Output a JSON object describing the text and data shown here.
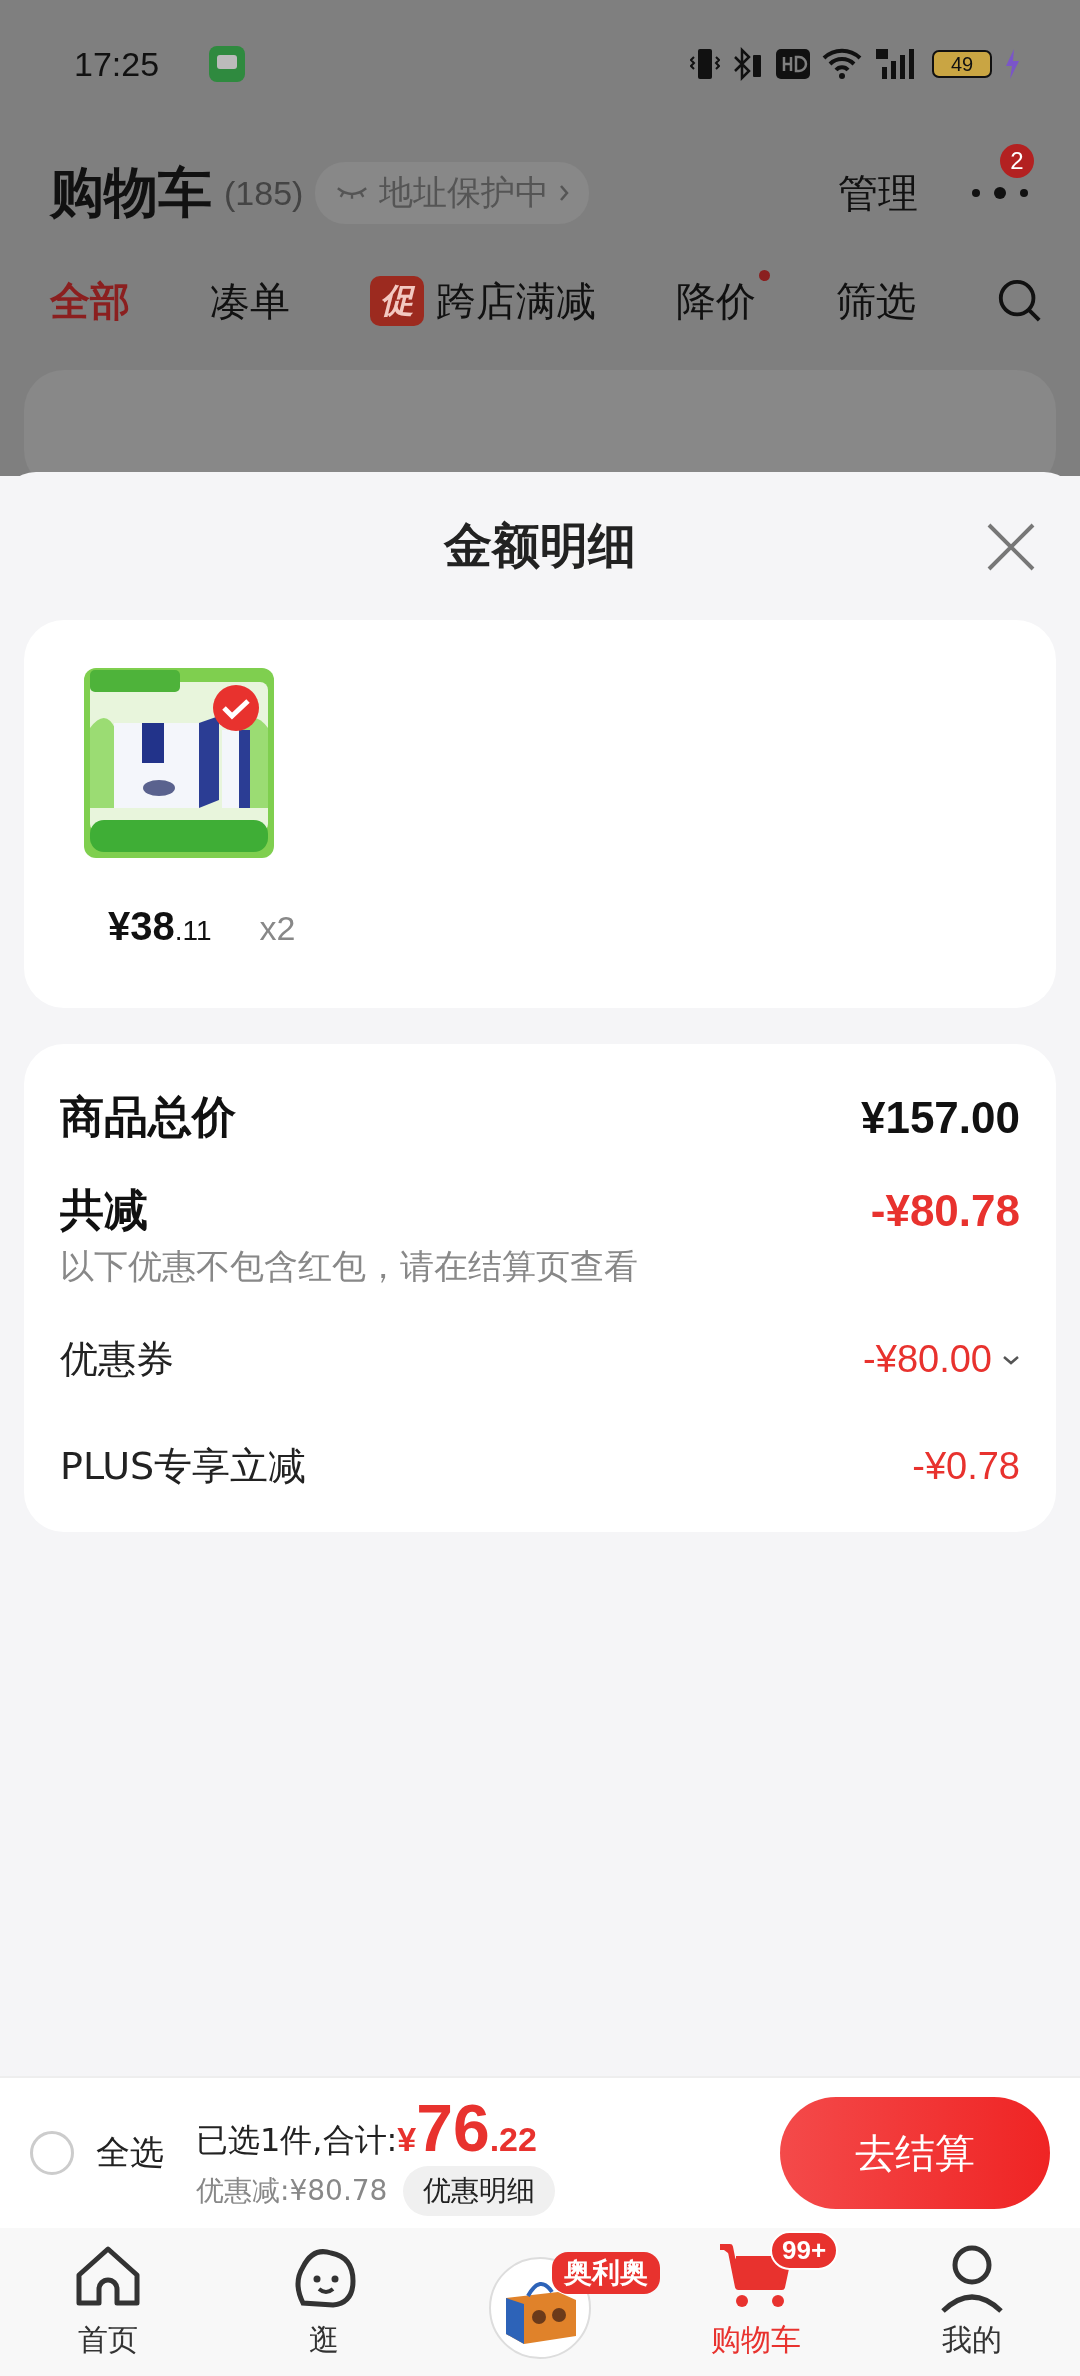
{
  "status_bar": {
    "time": "17:25",
    "battery": "49"
  },
  "header": {
    "title": "购物车",
    "count": "(185)",
    "address_chip": "地址保护中",
    "manage": "管理",
    "more_badge": "2"
  },
  "tabs": [
    {
      "label": "全部",
      "selected": true,
      "dot": false
    },
    {
      "label": "凑单",
      "selected": false,
      "dot": false
    },
    {
      "label": "跨店满减",
      "selected": false,
      "dot": false,
      "tag": "促"
    },
    {
      "label": "降价",
      "selected": false,
      "dot": true
    },
    {
      "label": "筛选",
      "selected": false,
      "dot": false
    }
  ],
  "sheet": {
    "title": "金额明细",
    "product": {
      "kind": "picture",
      "selected": true,
      "price_main": "¥38",
      "price_cents": ".11",
      "quantity": "x2"
    },
    "total": {
      "label": "商品总价",
      "value": "¥157.00"
    },
    "reduction": {
      "label": "共减",
      "value": "-¥80.78",
      "note": "以下优惠不包含红包，请在结算页查看"
    },
    "lines": [
      {
        "label": "优惠券",
        "value": "-¥80.00",
        "expandable": true
      },
      {
        "label": "PLUS专享立减",
        "value": "-¥0.78"
      }
    ]
  },
  "checkout_bar": {
    "select_all": {
      "label": "全选",
      "checked": false
    },
    "summary": "已选1件,合计:",
    "currency": "¥",
    "amount_main": "76",
    "amount_cents": ".22",
    "discount": "优惠减:¥80.78",
    "detail_button": "优惠明细",
    "checkout_button": "去结算"
  },
  "nav": [
    {
      "kind": "home",
      "label": "首页",
      "selected": false
    },
    {
      "kind": "face",
      "label": "逛",
      "selected": false
    },
    {
      "kind": "promo",
      "badge": "奥利奥"
    },
    {
      "kind": "cart",
      "label": "购物车",
      "badge": "99+",
      "selected": true
    },
    {
      "kind": "person",
      "label": "我的",
      "selected": false
    }
  ]
}
